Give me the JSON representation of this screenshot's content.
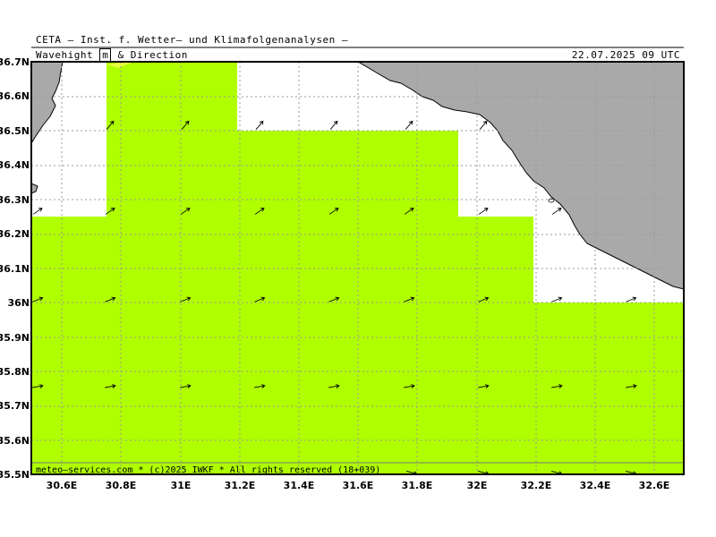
{
  "header": {
    "org": "CETA – Inst. f. Wetter– und Klimafolgenanalysen –",
    "param_pre": "Wavehight ",
    "param_unit": "m",
    "param_post": " & Direction",
    "datetime": "22.07.2025 09 UTC"
  },
  "footer": {
    "credit": "meteo–services.com * (c)2025 IWKF * All rights reserved (18+039)"
  },
  "map": {
    "lat_labels": [
      "36.7N",
      "36.6N",
      "36.5N",
      "36.4N",
      "36.3N",
      "36.2N",
      "36.1N",
      "36N",
      "35.9N",
      "35.8N",
      "35.7N",
      "35.6N",
      "35.5N"
    ],
    "lon_labels": [
      "30.6E",
      "30.8E",
      "31E",
      "31.2E",
      "31.4E",
      "31.6E",
      "31.8E",
      "32E",
      "32.2E",
      "32.4E",
      "32.6E"
    ],
    "colors": {
      "wave_fill": "#b0ff00",
      "land": "#a9a9a9",
      "sea": "#ffffff",
      "grid": "#9a9a9a"
    },
    "wave_direction": "north-east"
  }
}
